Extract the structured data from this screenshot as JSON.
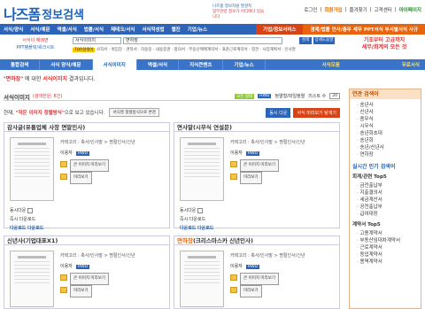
{
  "header": {
    "logo_main": "나즈폼",
    "logo_sub": "정보검색",
    "promo_line1": "나즈폼 정보자원 발견지",
    "promo_line2": "업무관련 정보가 어디에나 있습니다",
    "top_links": [
      "로그인",
      "회원가입",
      "즐겨찾기",
      "고객센터",
      "마이페이지"
    ]
  },
  "nav": {
    "items": [
      "서식/양식",
      "서식/예문",
      "엑셀/서식",
      "법률/서식",
      "재테크/서식",
      "서식작성법",
      "웹진",
      "기업/뉴스"
    ],
    "highlight_label": "기업/정보서비스",
    "right_label": "경제/법률 인사/총무 세무 PPT서식 부서별서식 사규"
  },
  "left_ad": {
    "line1": "서식이 해매면",
    "line2": "PPT템플릿/워크시트"
  },
  "search": {
    "category": "서식이미지",
    "query": "면하장",
    "button": "검색",
    "detail_button": "상세도움말",
    "tags_label": "TOP검색어",
    "tags": "사직서 · 위임장 · 견적서 · 차용증 · 내용증명 · 합의서 · 부동산매매계약서 · 표준근로계약서 · 정관 · 사업계획서 · 인사말"
  },
  "right_ad": {
    "line1": "기초부터 고급까지",
    "line2": "세무/회계의 모든 것"
  },
  "subtabs": {
    "items": [
      "통합검색",
      "서식 양식/예문",
      "서식이미지",
      "엑셀/서식",
      "지식큰밴츠",
      "기업/뉴스"
    ],
    "active_index": 2,
    "right1": "서식모음",
    "right2": "무료서식"
  },
  "result": {
    "query": "면하장",
    "text_before": "\"",
    "text_after": "\" 에 대한",
    "category": "서식이미지",
    "tail": "결과입니다."
  },
  "content": {
    "title": "서식이미지",
    "count": "(검색한원: 8건)",
    "opt_all": "모든 형태",
    "opt_fmt": "HWD",
    "opt_extra": "정렬형/파일정렬",
    "per_page_label": "리스트 수",
    "per_page": "20",
    "current_prefix": "현재,",
    "current_kw": "\"작은 이미지 정렬방식\"",
    "current_suffix": "으로 보고 있습니다.",
    "change_button": "서식명 정렬방식으로 변경",
    "btn_all": "동시 다운",
    "btn_preview": "서식 미리보기 탐색기"
  },
  "cards": [
    {
      "title": "감사글(유통업체 사장 면말인사)",
      "highlight": "",
      "category": "카테고리 : 축사/인사말 > 명절인사/신년",
      "format_label": "이용자",
      "format": "HWD",
      "preview_label": "큰 이미지 미리보기",
      "view_label": "미리보기",
      "bookmark_label": "동시다운",
      "dl_label": "즉시 다운로드",
      "dl1": "다운로드",
      "dl2": "다운로드"
    },
    {
      "title": "면사말(시무식 연설문)",
      "highlight": "",
      "category": "카테고리 : 축사/인사말 > 명절인사/신년",
      "format_label": "이용자",
      "format": "HWD",
      "preview_label": "큰 이미지 미리보기",
      "view_label": "미리보기",
      "bookmark_label": "동시다운",
      "dl_label": "즉시 다운로드",
      "dl1": "다운로드",
      "dl2": "다운로드"
    },
    {
      "title": "신년사(기업대표X1)",
      "highlight": "",
      "category": "카테고리 : 축사/인사말 > 명절인사/신년",
      "format_label": "이용자",
      "format": "HWD",
      "preview_label": "큰 이미지 미리보기",
      "view_label": "미리보기",
      "bookmark_label": "동시다운"
    },
    {
      "title": "(크리스마스카 신년인사)",
      "highlight": "면하장",
      "category": "카테고리 : 축사/인사말 > 명절인사/신년",
      "format_label": "이용자",
      "format": "HWD",
      "preview_label": "큰 이미지 미리보기",
      "view_label": "미리보기",
      "bookmark_label": "동시다운"
    }
  ],
  "sidebar": {
    "header": "연관 검색어",
    "related": [
      "송년사",
      "신년사",
      "종무식",
      "시무식",
      "송년회초대",
      "송년회",
      "송년/신년사",
      "연하장"
    ],
    "popular_header": "실시간 인기 검색어",
    "top5_header": "회계/관련 Top5",
    "top5": [
      "금전출납부",
      "지출결의서",
      "세금계산서",
      "공전출납부",
      "급여대장"
    ],
    "top5b_header": "계약서 Top5",
    "top5b": [
      "고용계약서",
      "부동산임대차계약서",
      "근로계약서",
      "동업계약서",
      "용역계약서"
    ]
  }
}
